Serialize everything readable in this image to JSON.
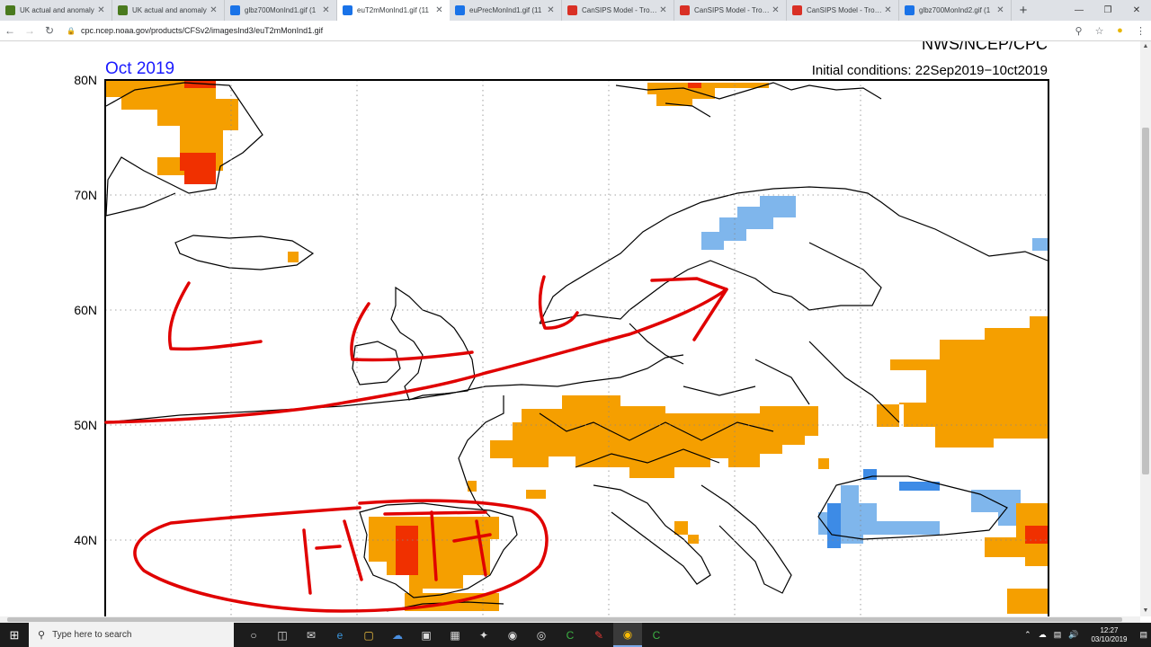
{
  "tabs": [
    {
      "title": "UK actual and anomaly",
      "color": "#4a7a1e",
      "active": false
    },
    {
      "title": "UK actual and anomaly",
      "color": "#4a7a1e",
      "active": false
    },
    {
      "title": "glbz700MonInd1.gif (1",
      "color": "#1a73e8",
      "active": false
    },
    {
      "title": "euT2mMonInd1.gif (11",
      "color": "#1a73e8",
      "active": true
    },
    {
      "title": "euPrecMonInd1.gif (11",
      "color": "#1a73e8",
      "active": false
    },
    {
      "title": "CanSIPS Model - Tropic",
      "color": "#d93025",
      "active": false
    },
    {
      "title": "CanSIPS Model - Tropic",
      "color": "#d93025",
      "active": false
    },
    {
      "title": "CanSIPS Model - Tropic",
      "color": "#d93025",
      "active": false
    },
    {
      "title": "glbz700MonInd2.gif (1",
      "color": "#1a73e8",
      "active": false
    }
  ],
  "address": {
    "url": "cpc.ncep.noaa.gov/products/CFSv2/imagesInd3/euT2mMonInd1.gif"
  },
  "map": {
    "month": "Oct 2019",
    "header_right": "NWS/NCEP/CPC",
    "initial_conditions": "Initial conditions: 22Sep2019−10ct2019",
    "lat_labels": [
      "80N",
      "70N",
      "60N",
      "50N",
      "40N"
    ],
    "colors": {
      "warm": "#f59f00",
      "hot": "#f03000",
      "cool": "#7fb6ec",
      "cold": "#3d8be6",
      "ink": "#e00000"
    }
  },
  "taskbar": {
    "search_placeholder": "Type here to search",
    "time": "12:27",
    "date": "03/10/2019"
  }
}
